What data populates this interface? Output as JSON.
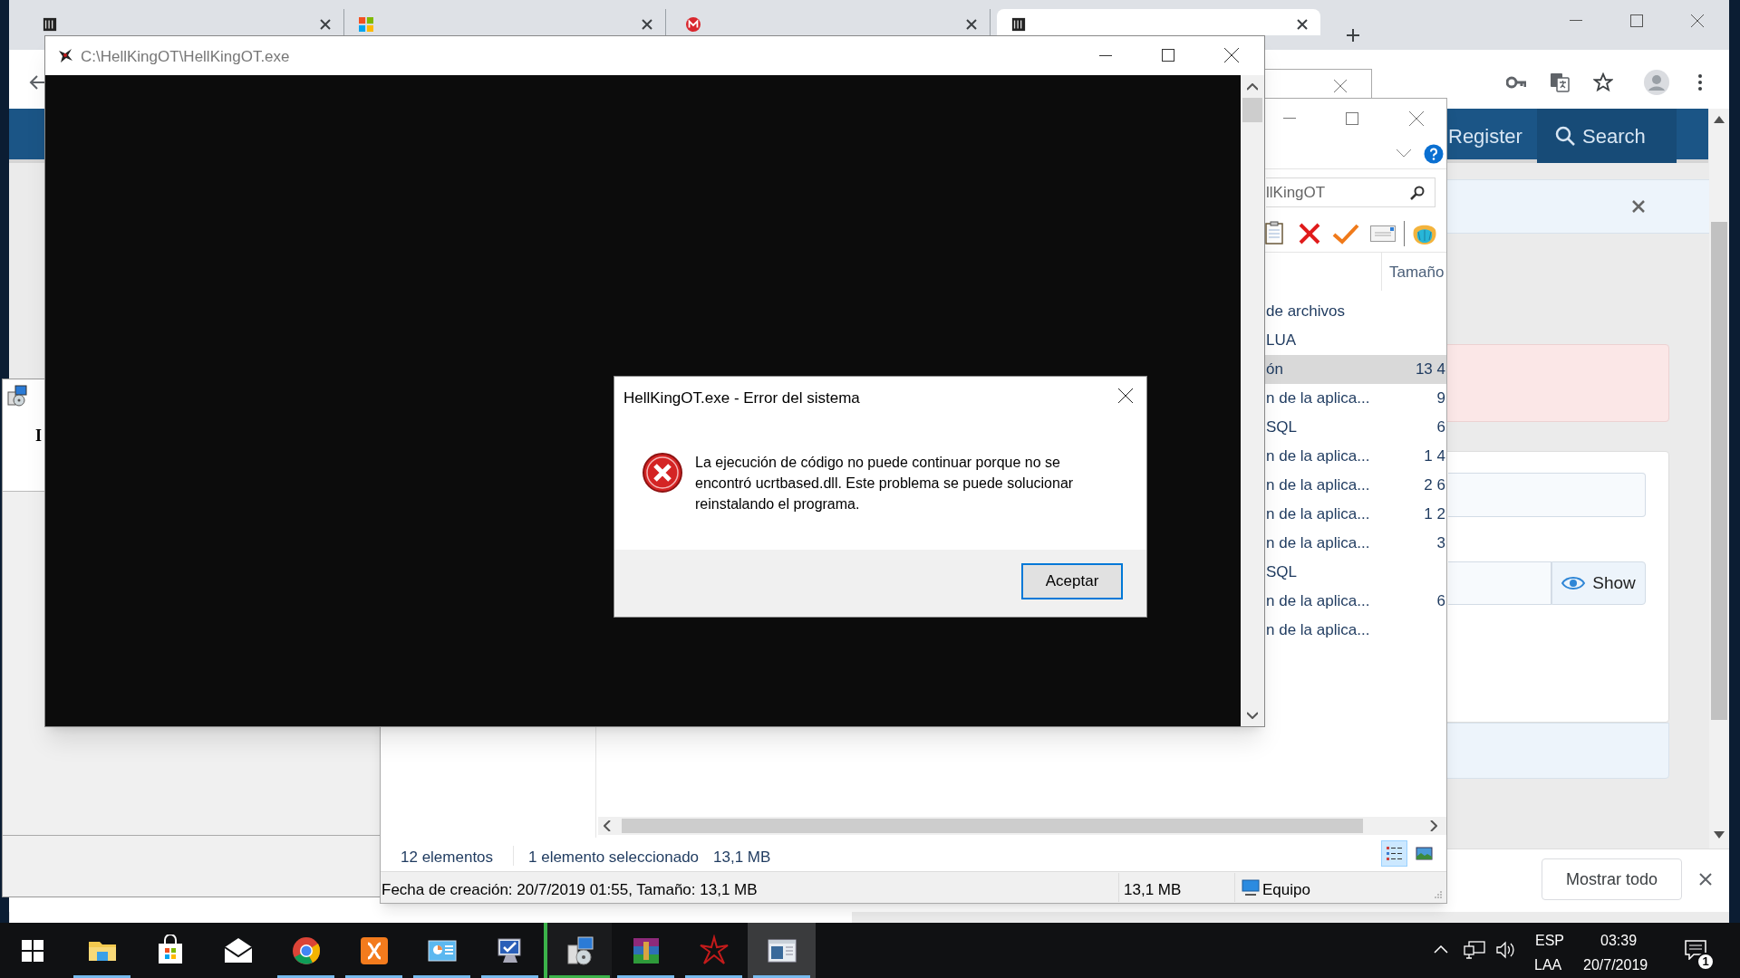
{
  "browser": {
    "tabs": [
      {
        "selected": false,
        "kind": "forum"
      },
      {
        "selected": false,
        "kind": "microsoft"
      },
      {
        "selected": false,
        "kind": "mega"
      },
      {
        "selected": true,
        "kind": "forum"
      }
    ],
    "site_nav": [
      "Register",
      "Search"
    ],
    "password_toggle": "Show",
    "show_all": "Mostrar todo"
  },
  "console_window": {
    "title": "C:\\HellKingOT\\HellKingOT.exe"
  },
  "error_dialog": {
    "title": "HellKingOT.exe - Error del sistema",
    "message": "La ejecución de código no puede continuar porque no se encontró ucrtbased.dll. Este problema se puede solucionar reinstalando el programa.",
    "button": "Aceptar"
  },
  "explorer": {
    "search": "llKingOT",
    "column": "Tamaño",
    "rows": [
      {
        "name": "de archivos",
        "selected": false
      },
      {
        "name": "LUA",
        "selected": false
      },
      {
        "name": "ón",
        "size": "13 4",
        "selected": true
      },
      {
        "name": "n de la aplica...",
        "size": "9",
        "selected": false
      },
      {
        "name": "SQL",
        "size": "6",
        "selected": false
      },
      {
        "name": "n de la aplica...",
        "size": "1 4",
        "selected": false
      },
      {
        "name": "n de la aplica...",
        "size": "2 6",
        "selected": false
      },
      {
        "name": "n de la aplica...",
        "size": "1 2",
        "selected": false
      },
      {
        "name": "n de la aplica...",
        "size": "3",
        "selected": false
      },
      {
        "name": "SQL",
        "selected": false
      },
      {
        "name": "n de la aplica...",
        "size": "6",
        "selected": false
      },
      {
        "name": "n de la aplica...",
        "selected": false
      }
    ],
    "status": {
      "count": "12 elementos",
      "selection": "1 elemento seleccionado",
      "selection_size": "13,1 MB"
    },
    "views": [
      {
        "kind": "details",
        "selected": true
      },
      {
        "kind": "icons",
        "selected": false
      }
    ],
    "details": {
      "info": "Fecha de creación: 20/7/2019 01:55, Tamaño: 13,1 MB",
      "size": "13,1 MB",
      "location": "Equipo"
    }
  },
  "setup_window": {
    "heading": "I"
  },
  "taskbar": {
    "apps": [
      {
        "kind": "file-explorer",
        "running": true,
        "progress": false,
        "selected": false
      },
      {
        "kind": "store",
        "running": false,
        "progress": false,
        "selected": false
      },
      {
        "kind": "mail",
        "running": false,
        "progress": false,
        "selected": false
      },
      {
        "kind": "chrome",
        "running": true,
        "progress": false,
        "selected": false
      },
      {
        "kind": "xampp",
        "running": true,
        "progress": false,
        "selected": false
      },
      {
        "kind": "control-panel",
        "running": true,
        "progress": false,
        "selected": false
      },
      {
        "kind": "monitor",
        "running": true,
        "progress": false,
        "selected": false
      },
      {
        "kind": "setup",
        "running": true,
        "progress": true,
        "selected": false
      },
      {
        "kind": "winrar",
        "running": true,
        "progress": false,
        "selected": false
      },
      {
        "kind": "game",
        "running": true,
        "progress": false,
        "selected": false
      },
      {
        "kind": "window",
        "running": true,
        "progress": false,
        "selected": true
      }
    ],
    "tray": {
      "language": "ESP",
      "layout": "LAA",
      "time": "03:39",
      "date": "20/7/2019",
      "notifications": "1"
    }
  }
}
